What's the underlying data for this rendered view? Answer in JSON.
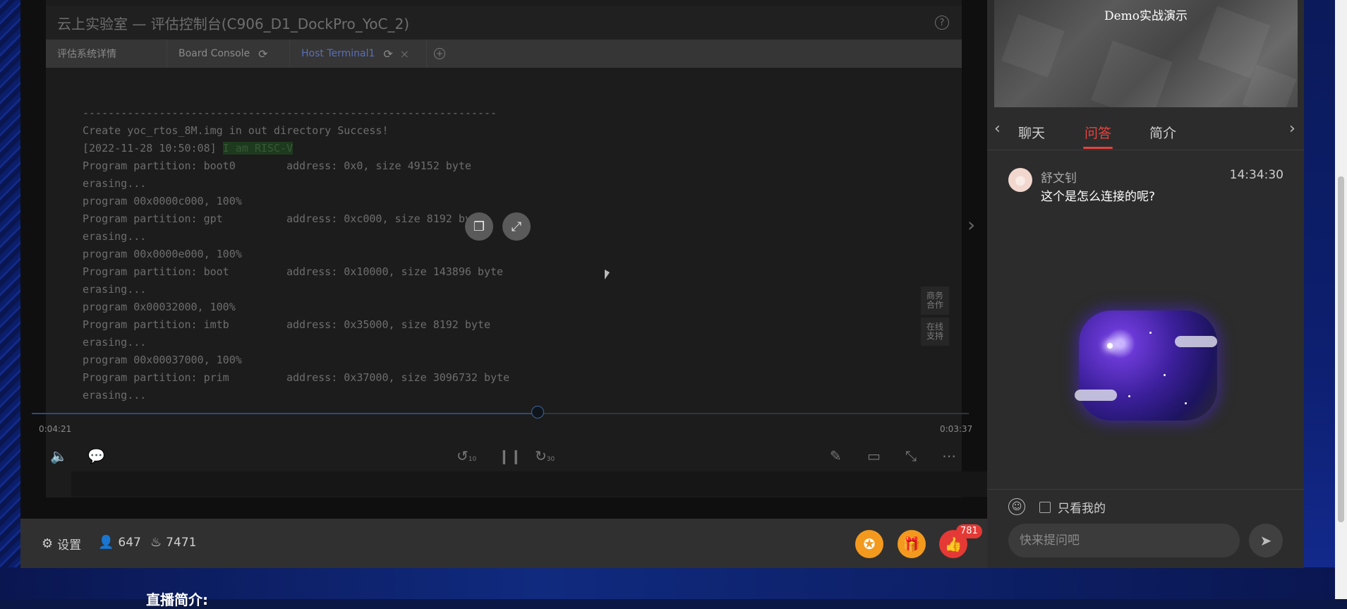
{
  "console": {
    "title": "云上实验室 — 评估控制台(C906_D1_DockPro_YoC_2)",
    "tabs": [
      {
        "label": "评估系统详情"
      },
      {
        "label": "Board Console"
      },
      {
        "label": "Host Terminal1"
      }
    ],
    "terminal_lines": [
      "-----------------------------------------------------------------",
      "Create yoc_rtos_8M.img in out directory Success!",
      "Program partition: boot0        address: 0x0, size 49152 byte",
      "erasing...",
      "program 00x0000c000, 100%",
      "Program partition: gpt          address: 0xc000, size 8192 byte",
      "erasing...",
      "program 00x0000e000, 100%",
      "Program partition: boot         address: 0x10000, size 143896 byte",
      "erasing...",
      "program 0x00032000, 100%",
      "Program partition: imtb         address: 0x35000, size 8192 byte",
      "erasing...",
      "program 00x00037000, 100%",
      "Program partition: prim         address: 0x37000, size 3096732 byte",
      "erasing..."
    ],
    "timestamp_prefix": "[2022-11-28 10:50:08] ",
    "timestamp_highlight": "I am RISC-V",
    "side_tags": [
      "商务\n合作",
      "在线\n支持"
    ]
  },
  "player": {
    "elapsed": "0:04:21",
    "remaining": "0:03:37",
    "progress": 0.54,
    "rewind_label": "10",
    "forward_label": "30"
  },
  "stats": {
    "settings_label": "设置",
    "viewers": "647",
    "heat": "7471",
    "likes_badge": "781"
  },
  "panel": {
    "banner_title": "Demo实战演示",
    "tabs": [
      "聊天",
      "问答",
      "简介"
    ],
    "active_tab": "问答",
    "qa": {
      "user": "舒文钊",
      "time": "14:34:30",
      "text": "这个是怎么连接的呢?"
    },
    "only_mine_label": "只看我的",
    "input_placeholder": "快来提问吧"
  },
  "page": {
    "intro_heading": "直播简介:"
  },
  "colors": {
    "accent": "#e8423e",
    "gift_orange": "#f39a1e",
    "like_red": "#e53935"
  }
}
